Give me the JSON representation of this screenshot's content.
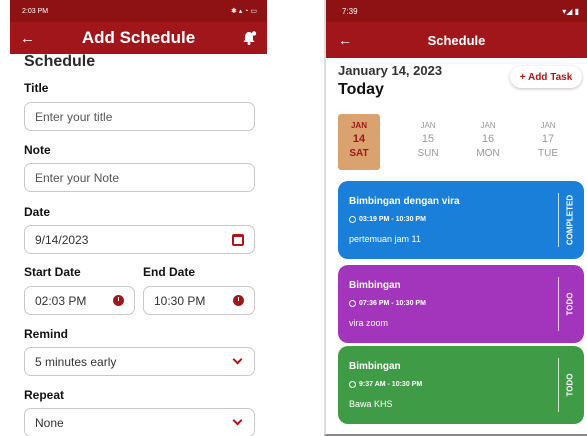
{
  "left": {
    "status_time": "2:03 PM",
    "app_title": "Add Schedule",
    "section_heading": "Schedule",
    "title_label": "Title",
    "title_placeholder": "Enter your title",
    "note_label": "Note",
    "note_placeholder": "Enter your Note",
    "date_label": "Date",
    "date_value": "9/14/2023",
    "start_label": "Start Date",
    "start_value": "02:03 PM",
    "end_label": "End Date",
    "end_value": "10:30 PM",
    "remind_label": "Remind",
    "remind_value": "5 minutes early",
    "repeat_label": "Repeat",
    "repeat_value": "None"
  },
  "right": {
    "status_time": "7:39",
    "app_title": "Schedule",
    "date_heading": "January 14, 2023",
    "today_label": "Today",
    "add_task_label": "+ Add Task",
    "days": [
      {
        "month": "JAN",
        "day": "14",
        "weekday": "SAT"
      },
      {
        "month": "JAN",
        "day": "15",
        "weekday": "SUN"
      },
      {
        "month": "JAN",
        "day": "16",
        "weekday": "MON"
      },
      {
        "month": "JAN",
        "day": "17",
        "weekday": "TUE"
      }
    ],
    "tasks": [
      {
        "title": "Bimbingan dengan vira",
        "time": "03:19 PM - 10:30 PM",
        "note": "pertemuan jam 11",
        "status": "COMPLETED",
        "color": "#1a7fd8"
      },
      {
        "title": "Bimbingan",
        "time": "07:36 PM - 10:30 PM",
        "note": "vira zoom",
        "status": "TODO",
        "color": "#a235bb"
      },
      {
        "title": "Bimbingan",
        "time": "9:37 AM - 10:30 PM",
        "note": "Bawa KHS",
        "status": "TODO",
        "color": "#3f9b45"
      }
    ]
  },
  "colors": {
    "brand_red": "#a0161b",
    "selected_day_bg": "#d9a26e"
  }
}
